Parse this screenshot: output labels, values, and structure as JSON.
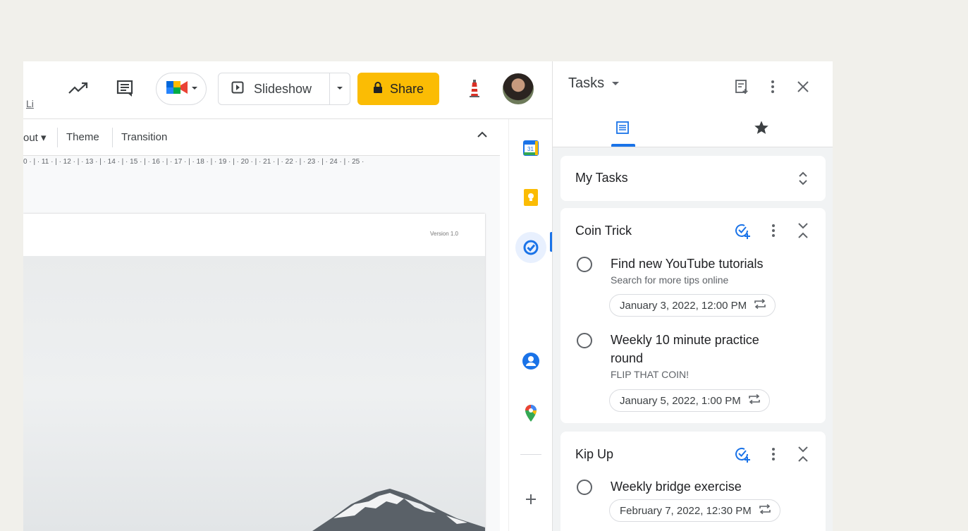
{
  "topbar": {
    "menu_edge_text": "Li",
    "slideshow_label": "Slideshow",
    "share_label": "Share"
  },
  "toolbar": {
    "layout_partial": "out",
    "theme_label": "Theme",
    "transition_label": "Transition"
  },
  "ruler": {
    "text": "0 · | · 11 · | · 12 · | · 13 · | · 14 · | · 15 · | · 16 · | · 17 · | · 18 · | · 19 · | · 20 · | · 21 · | · 22 · | · 23 · | · 24 · | · 25 ·"
  },
  "slide": {
    "version_text": "Version 1.0"
  },
  "side_panel": {
    "calendar_day": "31"
  },
  "tasks": {
    "title": "Tasks",
    "list_selector": "My Tasks",
    "lists": [
      {
        "name": "Coin Trick",
        "items": [
          {
            "title": "Find new YouTube tutorials",
            "subtitle": "Search for more tips online",
            "date": "January 3, 2022, 12:00 PM"
          },
          {
            "title": "Weekly 10 minute practice round",
            "subtitle": "FLIP THAT COIN!",
            "date": "January 5, 2022, 1:00 PM"
          }
        ]
      },
      {
        "name": "Kip Up",
        "items": [
          {
            "title": "Weekly bridge exercise",
            "subtitle": "",
            "date": "February 7, 2022, 12:30 PM"
          }
        ]
      }
    ]
  },
  "colors": {
    "share_bg": "#fbbc04",
    "accent_blue": "#1a73e8",
    "page_bg": "#f1f0eb"
  }
}
